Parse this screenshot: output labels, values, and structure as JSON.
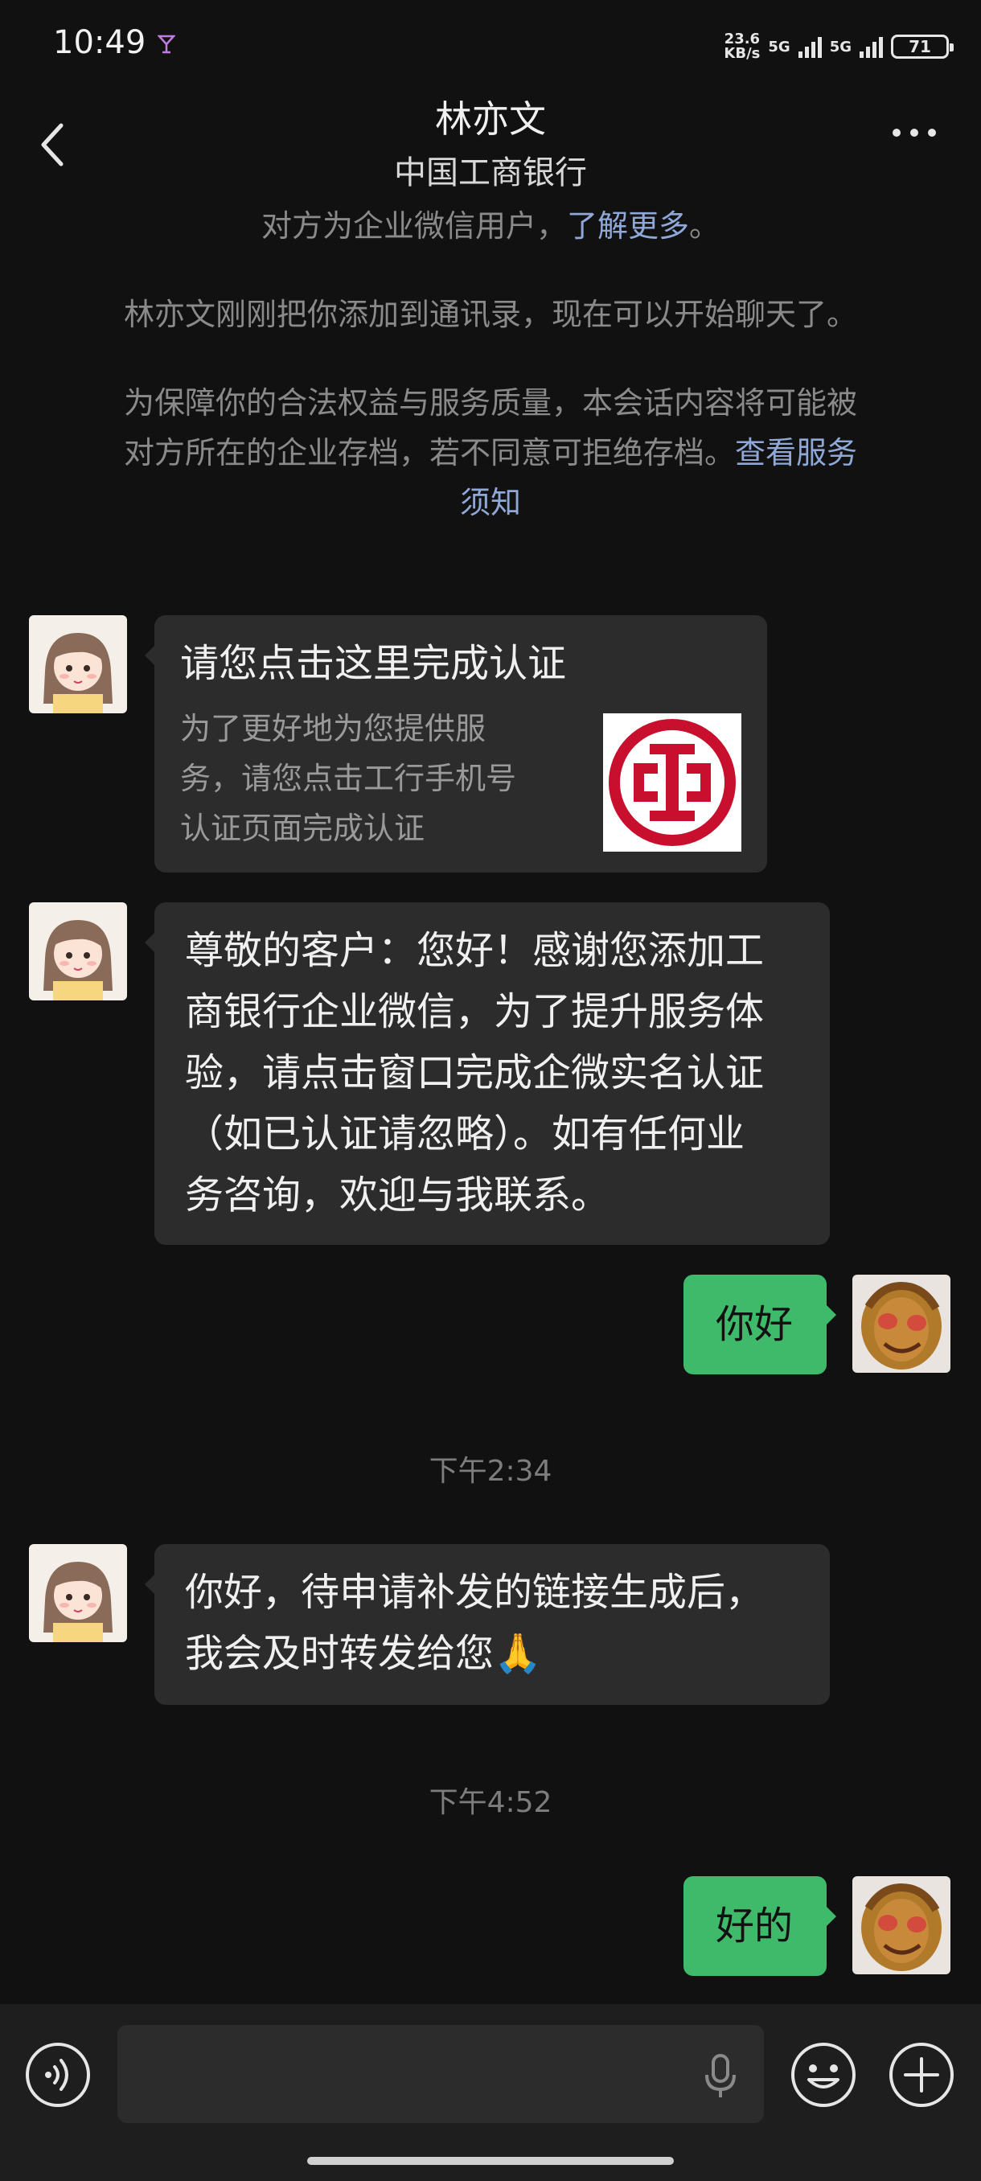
{
  "status_bar": {
    "time": "10:49",
    "speed_value": "23.6",
    "speed_unit": "KB/s",
    "network1": "5G",
    "network2": "5G",
    "battery": "71"
  },
  "header": {
    "title": "林亦文",
    "subtitle": "中国工商银行"
  },
  "system_notes": {
    "enterprise_prefix": "对方为企业微信用户，",
    "enterprise_link": "了解更多",
    "enterprise_suffix": "。",
    "added": "林亦文刚刚把你添加到通讯录，现在可以开始聊天了。",
    "archive_line1": "为保障你的合法权益与服务质量，本会话内容将可能被",
    "archive_line2": "对方所在的企业存档，若不同意可拒绝存档。",
    "archive_link_part1": "查看服务",
    "archive_link_part2": "须知"
  },
  "messages": {
    "card": {
      "title": "请您点击这里完成认证",
      "desc_line1": "为了更好地为您提供服",
      "desc_line2": "务，请您点击工行手机号",
      "desc_line3": "认证页面完成认证"
    },
    "notice": {
      "line1": "尊敬的客户：您好！感谢您添加工",
      "line2": "商银行企业微信，为了提升服务体",
      "line3": "验，请点击窗口完成企微实名认证",
      "line4": "（如已认证请忽略）。如有任何业",
      "line5": "务咨询，欢迎与我联系。"
    },
    "hello_sent": "你好",
    "time1": "下午2:34",
    "reply": {
      "line1": "你好，待申请补发的链接生成后，",
      "line2": "我会及时转发给您",
      "emoji": "🙏"
    },
    "time2": "下午4:52",
    "ok_sent": "好的"
  },
  "colors": {
    "background": "#111111",
    "bubble_gray": "#2c2c2c",
    "bubble_green": "#3fb96a",
    "link": "#8fa8d8",
    "icbc_red": "#c8102e"
  },
  "icons": {
    "back": "chevron-left-icon",
    "more": "more-dots-icon",
    "voice": "voice-toggle-icon",
    "mic": "microphone-icon",
    "emoji": "emoji-icon",
    "plus": "plus-icon"
  }
}
